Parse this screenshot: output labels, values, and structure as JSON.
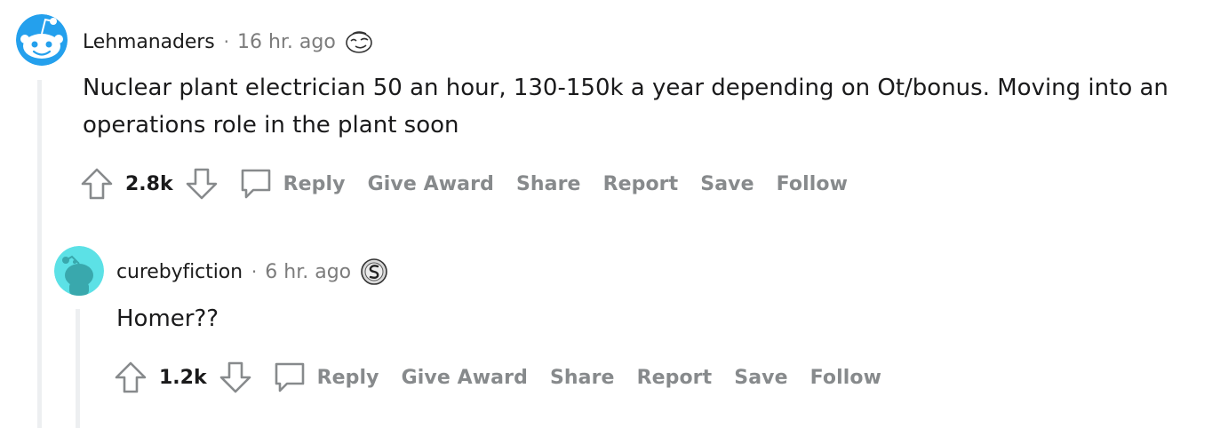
{
  "comments": [
    {
      "username": "Lehmanaders",
      "separator": "·",
      "time": "16 hr. ago",
      "flair_icon": "smug-face-flair-icon",
      "body": "Nuclear plant electrician 50 an hour, 130-150k a year depending on Ot/bonus. Moving into an operations role in the plant soon",
      "score": "2.8k",
      "actions": {
        "reply": "Reply",
        "give_award": "Give Award",
        "share": "Share",
        "report": "Report",
        "save": "Save",
        "follow": "Follow"
      },
      "avatar_color": "#24a0ed"
    },
    {
      "username": "curebyfiction",
      "separator": "·",
      "time": "6 hr. ago",
      "flair_icon": "silver-coin-flair-icon",
      "body": "Homer??",
      "score": "1.2k",
      "actions": {
        "reply": "Reply",
        "give_award": "Give Award",
        "share": "Share",
        "report": "Report",
        "save": "Save",
        "follow": "Follow"
      },
      "avatar_color": "#5ce1e6"
    }
  ],
  "colors": {
    "action_text": "#878a8c",
    "meta_text": "#7c7c7c",
    "thread_line": "#edeff1"
  }
}
